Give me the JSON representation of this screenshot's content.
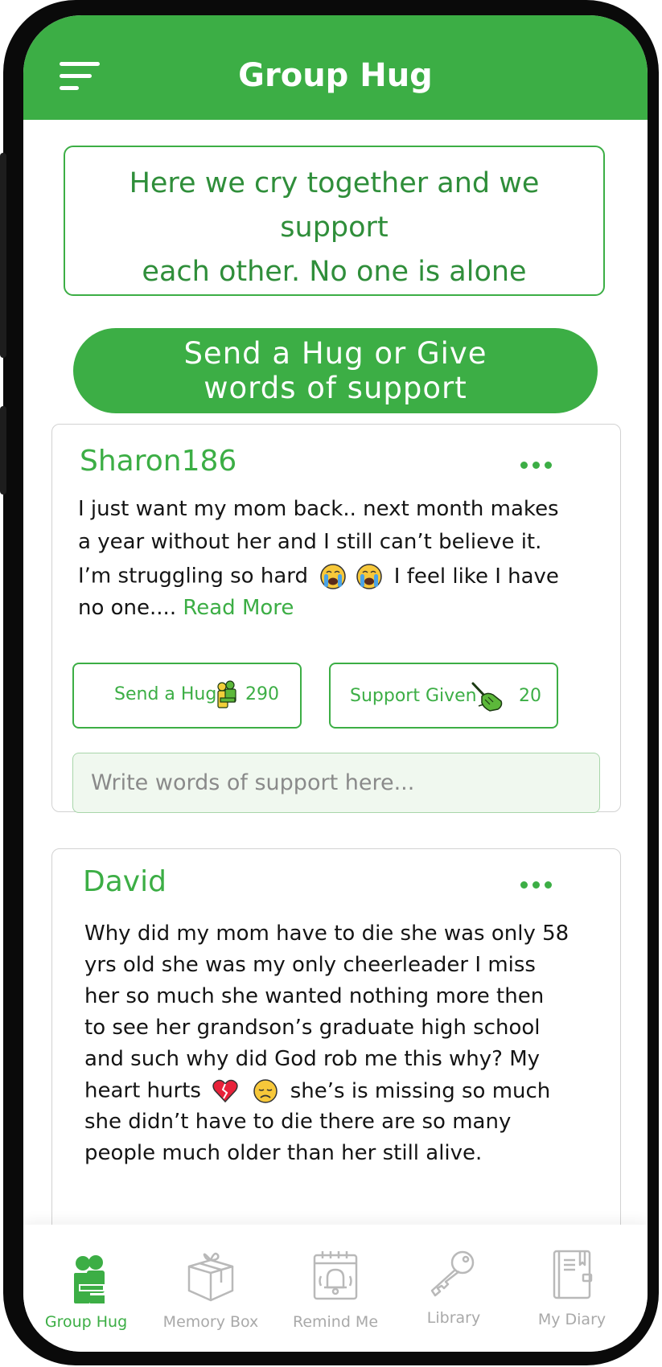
{
  "app": {
    "title": "Group Hug"
  },
  "intro": {
    "line1": "Here we cry together and we support",
    "line2": "each other. No one is alone"
  },
  "cta": {
    "line1": "Send a Hug or Give",
    "line2": "words of support"
  },
  "posts": [
    {
      "user": "Sharon186",
      "lines": [
        "I just want my mom back.. next month makes",
        "a year without her and I still can’t believe it.",
        "I’m struggling so hard",
        "I feel like I have",
        "no one.... "
      ],
      "read_more": "Read More",
      "hug_label": "Send a Hug",
      "hug_count": "290",
      "support_label": "Support Given",
      "support_count": "20",
      "input_placeholder": "Write words of support here..."
    },
    {
      "user": "David",
      "lines": [
        "Why did my mom have to die she was only 58",
        "yrs old she was my only cheerleader I miss",
        "her so much she wanted nothing more then",
        "to see her grandson’s graduate high school",
        "and such why did God rob me this why? My",
        "heart hurts",
        "she’s is missing so much",
        "she didn’t have to die there are so many",
        "people much older than her still alive."
      ]
    }
  ],
  "tabs": [
    {
      "label": "Group Hug",
      "icon": "group-hug-icon",
      "active": true
    },
    {
      "label": "Memory Box",
      "icon": "gift-box-icon",
      "active": false
    },
    {
      "label": "Remind Me",
      "icon": "calendar-bell-icon",
      "active": false
    },
    {
      "label": "Library",
      "icon": "key-icon",
      "active": false
    },
    {
      "label": "My Diary",
      "icon": "diary-icon",
      "active": false
    }
  ],
  "colors": {
    "accent": "#3cae45",
    "frame": "#0a0a0a",
    "inactive": "#a9a9a9"
  }
}
